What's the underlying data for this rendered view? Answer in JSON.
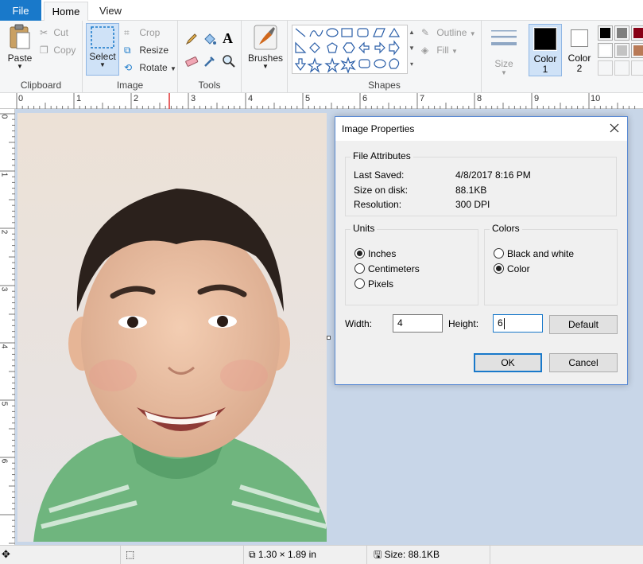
{
  "menu": {
    "file": "File",
    "home": "Home",
    "view": "View"
  },
  "ribbon": {
    "clipboard": {
      "label": "Clipboard",
      "paste": "Paste",
      "cut": "Cut",
      "copy": "Copy"
    },
    "image": {
      "label": "Image",
      "select": "Select",
      "crop": "Crop",
      "resize": "Resize",
      "rotate": "Rotate"
    },
    "tools": {
      "label": "Tools"
    },
    "brushes": "Brushes",
    "shapes": {
      "label": "Shapes",
      "outline": "Outline",
      "fill": "Fill"
    },
    "size": "Size",
    "color1": {
      "line1": "Color",
      "line2": "1"
    },
    "color2": {
      "line1": "Color",
      "line2": "2"
    },
    "palette": [
      "#000000",
      "#7f7f7f",
      "#880015",
      "#ffffff",
      "#c3c3c3",
      "#b97a57"
    ]
  },
  "ruler": {
    "marks": [
      "0",
      "1",
      "2",
      "3",
      "4",
      "5",
      "6",
      "7",
      "8",
      "9",
      "10"
    ],
    "vmarks": [
      "0",
      "1",
      "2",
      "3",
      "4",
      "5",
      "6"
    ]
  },
  "dialog": {
    "title": "Image Properties",
    "attributes": {
      "legend": "File Attributes",
      "last_saved_label": "Last Saved:",
      "last_saved_value": "4/8/2017 8:16 PM",
      "size_label": "Size on disk:",
      "size_value": "88.1KB",
      "resolution_label": "Resolution:",
      "resolution_value": "300 DPI"
    },
    "units": {
      "legend": "Units",
      "inches": "Inches",
      "centimeters": "Centimeters",
      "pixels": "Pixels",
      "selected": "inches"
    },
    "colors": {
      "legend": "Colors",
      "bw": "Black and white",
      "color": "Color",
      "selected": "color"
    },
    "width_label": "Width:",
    "width_value": "4",
    "height_label": "Height:",
    "height_value": "6",
    "default_btn": "Default",
    "ok_btn": "OK",
    "cancel_btn": "Cancel"
  },
  "status": {
    "dimensions": "1.30 × 1.89 in",
    "size": "Size: 88.1KB"
  }
}
